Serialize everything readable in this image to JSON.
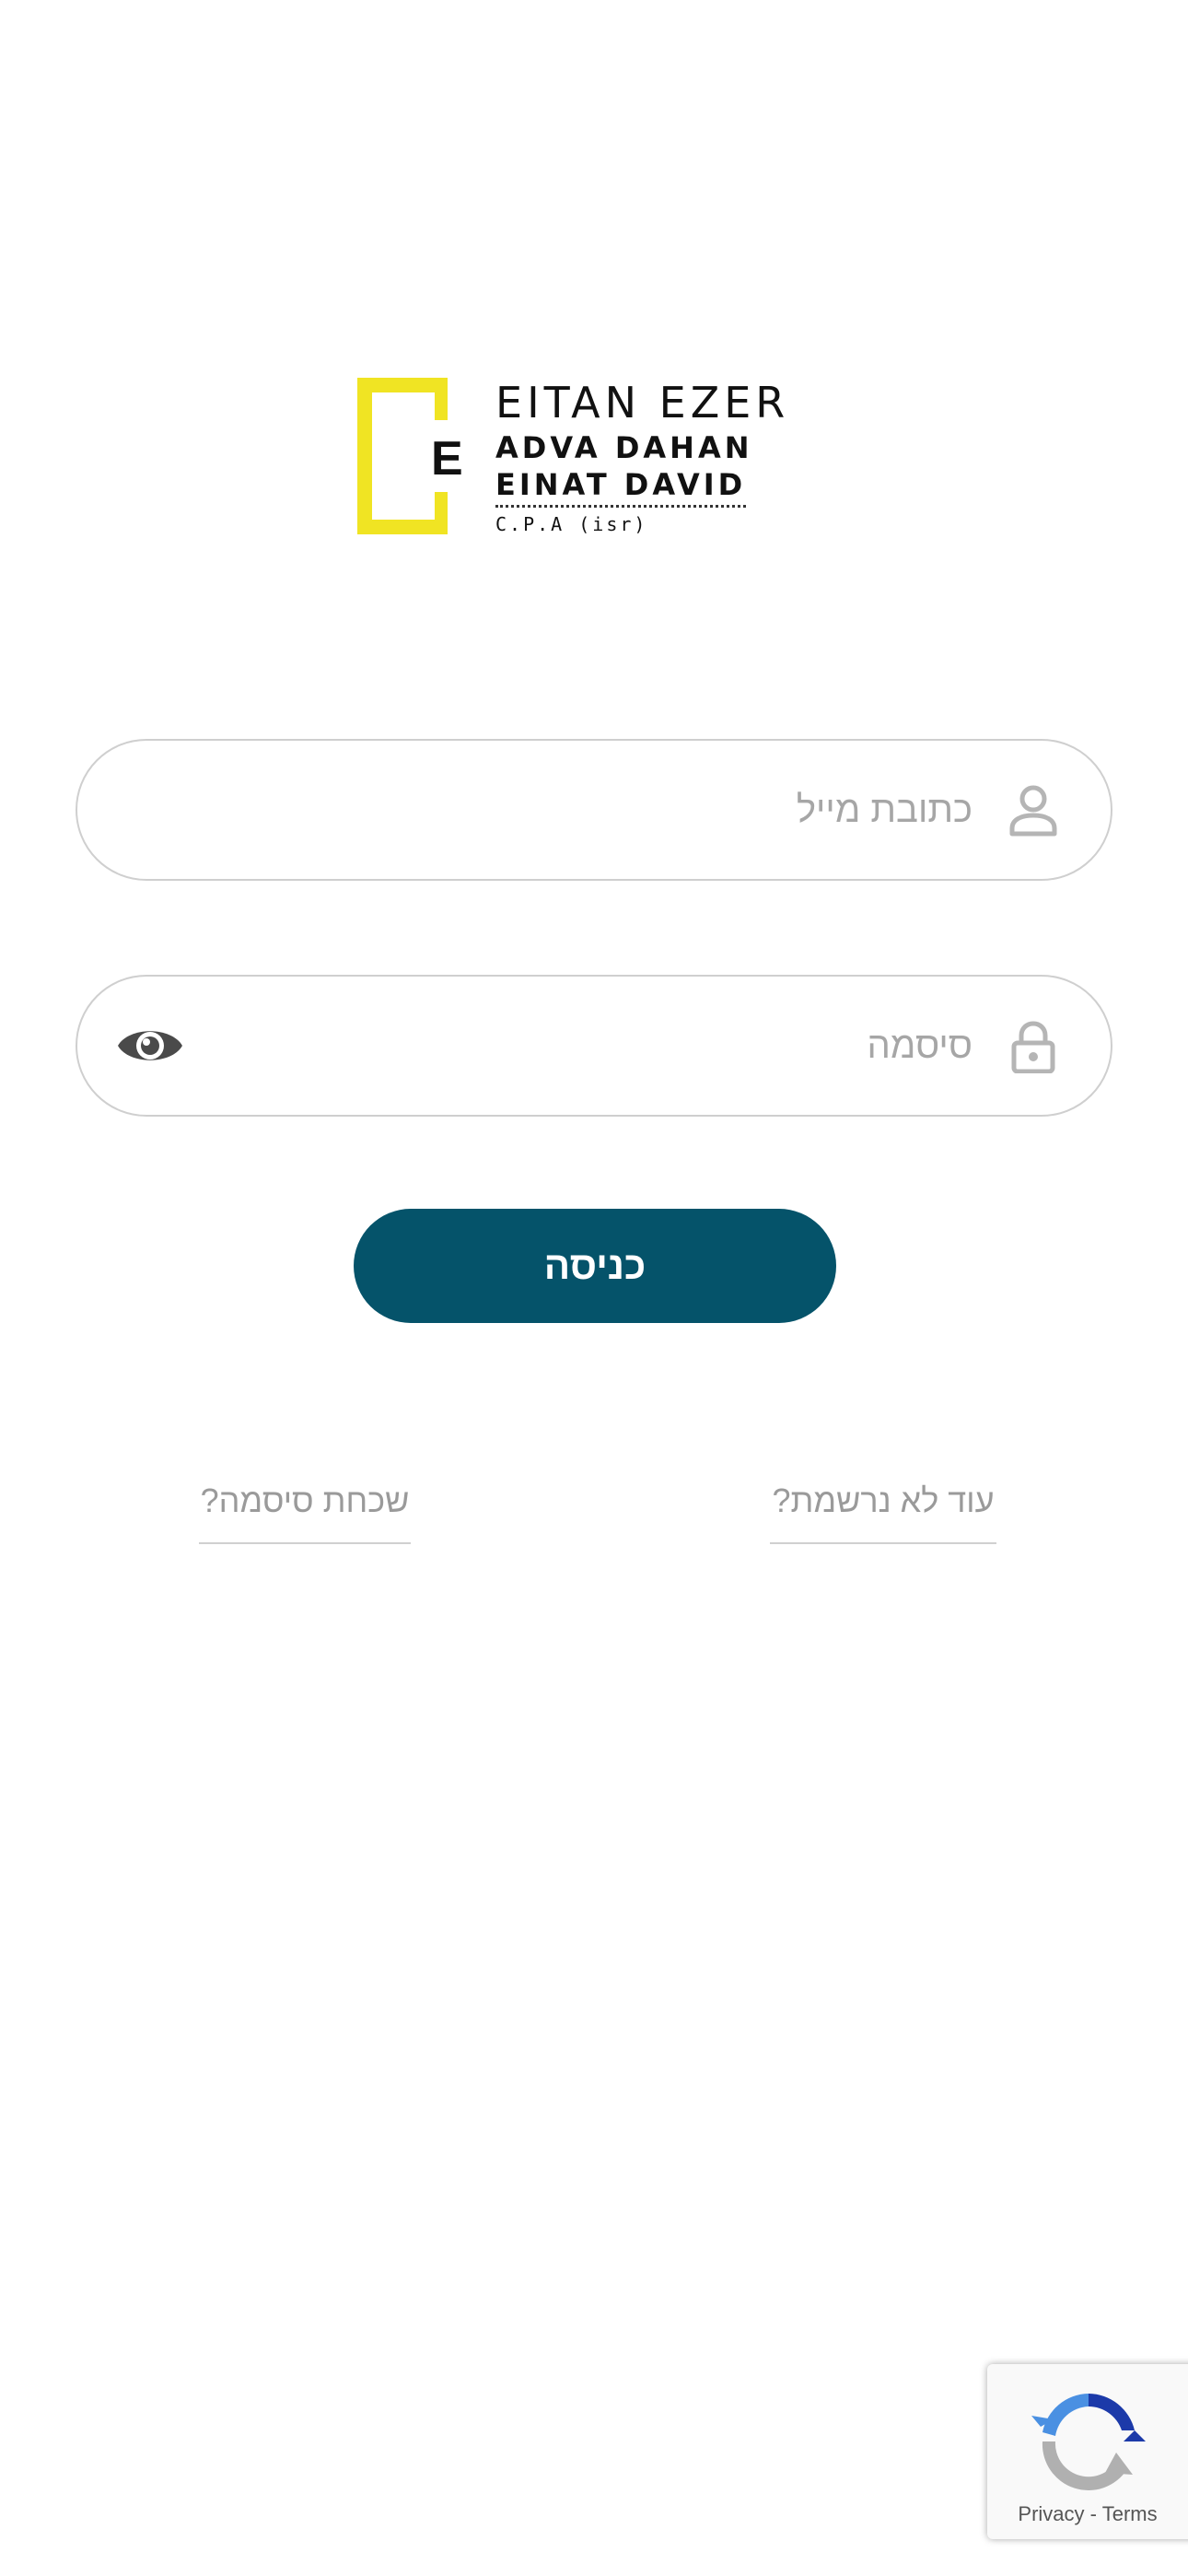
{
  "logo": {
    "letter": "E",
    "line1": "EITAN EZER",
    "line2": "ADVA DAHAN",
    "line3": "EINAT DAVID",
    "line4": "C.P.A (isr)",
    "accent_color": "#f0e423"
  },
  "form": {
    "email": {
      "placeholder": "כתובת מייל",
      "value": "",
      "icon": "user-icon"
    },
    "password": {
      "placeholder": "סיסמה",
      "value": "",
      "icon": "lock-icon",
      "toggle_icon": "eye-icon"
    },
    "login_label": "כניסה",
    "button_color": "#05536a"
  },
  "links": {
    "register": "עוד לא נרשמת?",
    "forgot": "שכחת סיסמה?"
  },
  "recaptcha": {
    "privacy": "Privacy",
    "separator": "-",
    "terms": "Terms"
  }
}
